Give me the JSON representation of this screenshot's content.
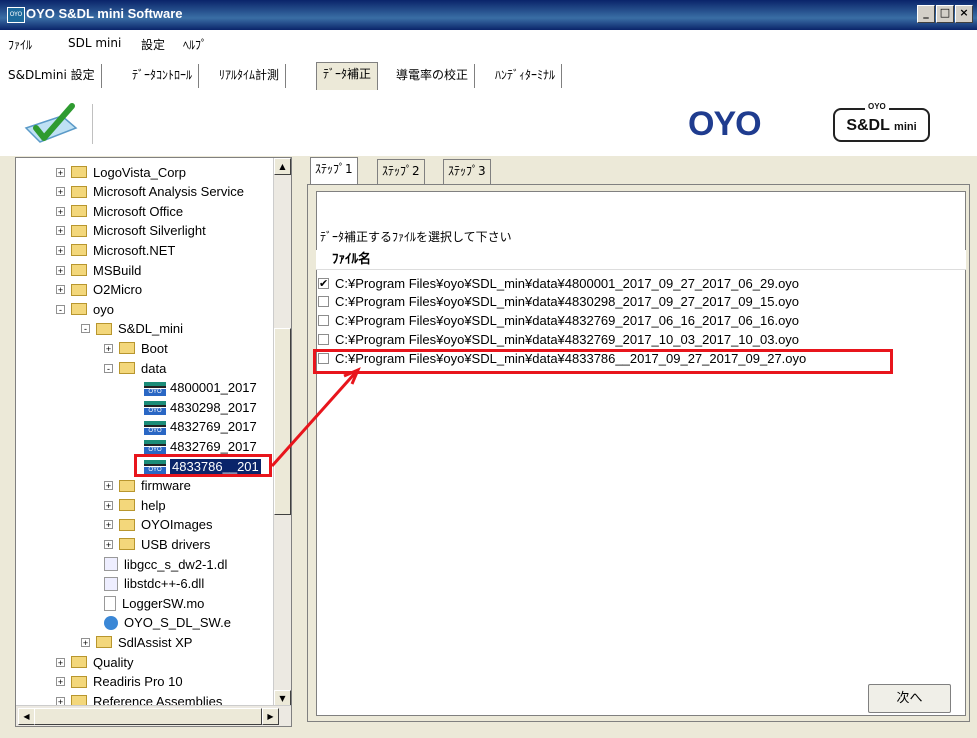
{
  "window": {
    "title": "OYO S&DL mini Software",
    "app_icon_text": "OYO",
    "controls": [
      "_",
      "□",
      "×"
    ]
  },
  "menu": [
    "ﾌｧｲﾙ",
    "SDL mini",
    "設定",
    "ﾍﾙﾌﾟ"
  ],
  "main_tabs": [
    {
      "label": "S&DLmini 設定",
      "active": false
    },
    {
      "label": "ﾃﾞｰﾀｺﾝﾄﾛｰﾙ",
      "active": false
    },
    {
      "label": "ﾘｱﾙﾀｲﾑ計測",
      "active": false
    },
    {
      "label": "ﾃﾞｰﾀ補正",
      "active": true
    },
    {
      "label": "導電率の校正",
      "active": false
    },
    {
      "label": "ﾊﾝﾃﾞｨﾀｰﾐﾅﾙ",
      "active": false
    }
  ],
  "toolbar": {
    "check_icon": "check-icon",
    "brand_logo": "OYO",
    "product_logo_main": "S&DL",
    "product_logo_sub": "mini",
    "product_logo_cap": "OYO"
  },
  "tree": [
    {
      "label": "LogoVista_Corp",
      "expander": "+",
      "icon": "folder",
      "depth": 0
    },
    {
      "label": "Microsoft Analysis Service",
      "expander": "+",
      "icon": "folder",
      "depth": 0
    },
    {
      "label": "Microsoft Office",
      "expander": "+",
      "icon": "folder",
      "depth": 0
    },
    {
      "label": "Microsoft Silverlight",
      "expander": "+",
      "icon": "folder",
      "depth": 0
    },
    {
      "label": "Microsoft.NET",
      "expander": "+",
      "icon": "folder",
      "depth": 0
    },
    {
      "label": "MSBuild",
      "expander": "+",
      "icon": "folder",
      "depth": 0
    },
    {
      "label": "O2Micro",
      "expander": "+",
      "icon": "folder",
      "depth": 0
    },
    {
      "label": "oyo",
      "expander": "-",
      "icon": "folder",
      "depth": 0
    },
    {
      "label": "S&DL_mini",
      "expander": "-",
      "icon": "folder",
      "depth": 1
    },
    {
      "label": "Boot",
      "expander": "+",
      "icon": "folder",
      "depth": 2
    },
    {
      "label": "data",
      "expander": "-",
      "icon": "folder",
      "depth": 2
    },
    {
      "label": "4800001_2017",
      "expander": "",
      "icon": "oyo",
      "depth": 3
    },
    {
      "label": "4830298_2017",
      "expander": "",
      "icon": "oyo",
      "depth": 3
    },
    {
      "label": "4832769_2017",
      "expander": "",
      "icon": "oyo",
      "depth": 3
    },
    {
      "label": "4832769_2017",
      "expander": "",
      "icon": "oyo",
      "depth": 3
    },
    {
      "label": "4833786__201",
      "expander": "",
      "icon": "oyo",
      "depth": 3,
      "selected": true
    },
    {
      "label": "firmware",
      "expander": "+",
      "icon": "folder",
      "depth": 2
    },
    {
      "label": "help",
      "expander": "+",
      "icon": "folder",
      "depth": 2
    },
    {
      "label": "OYOImages",
      "expander": "+",
      "icon": "folder",
      "depth": 2
    },
    {
      "label": "USB drivers",
      "expander": "+",
      "icon": "folder",
      "depth": 2
    },
    {
      "label": "libgcc_s_dw2-1.dl",
      "expander": "",
      "icon": "dll",
      "depth": 2
    },
    {
      "label": "libstdc++-6.dll",
      "expander": "",
      "icon": "dll",
      "depth": 2
    },
    {
      "label": "LoggerSW.mo",
      "expander": "",
      "icon": "mo",
      "depth": 2
    },
    {
      "label": "OYO_S_DL_SW.e",
      "expander": "",
      "icon": "exe",
      "depth": 2
    },
    {
      "label": "SdlAssist XP",
      "expander": "+",
      "icon": "folder",
      "depth": 1
    },
    {
      "label": "Quality",
      "expander": "+",
      "icon": "folder",
      "depth": 0
    },
    {
      "label": "Readiris Pro 10",
      "expander": "+",
      "icon": "folder",
      "depth": 0
    },
    {
      "label": "Reference Assemblies",
      "expander": "+",
      "icon": "folder",
      "depth": 0
    }
  ],
  "step_tabs": [
    {
      "label": "ｽﾃｯﾌﾟ1",
      "active": true
    },
    {
      "label": "ｽﾃｯﾌﾟ2",
      "active": false
    },
    {
      "label": "ｽﾃｯﾌﾟ3",
      "active": false
    }
  ],
  "step1": {
    "instruction": "ﾃﾞｰﾀ補正するﾌｧｲﾙを選択して下さい",
    "column_header": "ﾌｧｲﾙ名",
    "files": [
      {
        "path": "C:¥Program Files¥oyo¥SDL_min¥data¥4800001_2017_09_27_2017_06_29.oyo",
        "checked": true
      },
      {
        "path": "C:¥Program Files¥oyo¥SDL_min¥data¥4830298_2017_09_27_2017_09_15.oyo",
        "checked": false
      },
      {
        "path": "C:¥Program Files¥oyo¥SDL_min¥data¥4832769_2017_06_16_2017_06_16.oyo",
        "checked": false
      },
      {
        "path": "C:¥Program Files¥oyo¥SDL_min¥data¥4832769_2017_10_03_2017_10_03.oyo",
        "checked": false
      },
      {
        "path": "C:¥Program Files¥oyo¥SDL_min¥data¥4833786__2017_09_27_2017_09_27.oyo",
        "checked": false
      }
    ],
    "next_label": "次へ"
  },
  "colors": {
    "highlight": "#e8151c",
    "selection": "#0a246a",
    "brand_blue": "#1f3c8f"
  }
}
